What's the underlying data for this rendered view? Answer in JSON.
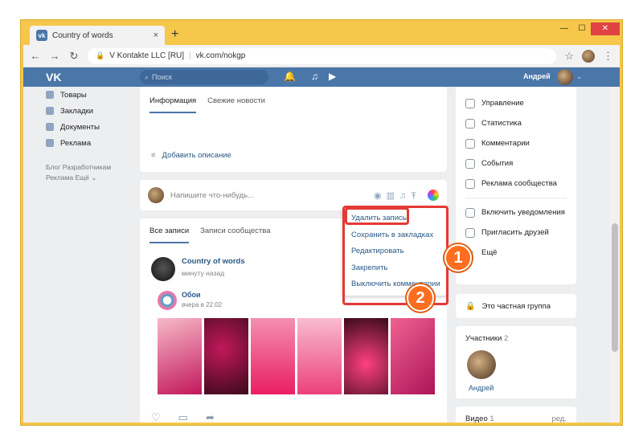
{
  "browser": {
    "tab_title": "Country of words",
    "tab_close": "×",
    "new_tab": "+",
    "address_origin": "V Kontakte LLC [RU]",
    "address_path": "vk.com/nokgp",
    "window_controls": [
      "—",
      "☐",
      "✕"
    ]
  },
  "vk_header": {
    "logo": "VK",
    "search_placeholder": "Поиск",
    "user_name": "Андрей"
  },
  "left_nav": {
    "items": [
      "Товары",
      "Закладки",
      "Документы",
      "Реклама"
    ],
    "footer_line1": "Блог   Разработчикам",
    "footer_line2": "Реклама   Ещё ⌄"
  },
  "info_card": {
    "tabs": [
      "Информация",
      "Свежие новости"
    ],
    "add_description": "Добавить описание"
  },
  "composer": {
    "placeholder": "Напишите что-нибудь..."
  },
  "wall": {
    "tabs": [
      "Все записи",
      "Записи сообщества"
    ],
    "post_author": "Country of words",
    "post_time": "минуту назад",
    "repost_author": "Обои",
    "repost_time": "вчера в 22:02"
  },
  "post_menu": {
    "items": [
      "Удалить запись",
      "Сохранить в закладках",
      "Редактировать",
      "Закрепить",
      "Выключить комментарии"
    ]
  },
  "right_col": {
    "items": [
      "Управление",
      "Статистика",
      "Комментарии",
      "События",
      "Реклама сообщества"
    ],
    "items2": [
      "Включить уведомления",
      "Пригласить друзей",
      "Ещё"
    ],
    "private_group": "Это частная группа",
    "members_label": "Участники",
    "members_count": "2",
    "member_name": "Андрей",
    "video_label": "Видео",
    "video_count": "1",
    "video_edit": "ред."
  },
  "badges": [
    "1",
    "2"
  ],
  "colors": {
    "vk_blue": "#4a76a8",
    "highlight_red": "#e53935",
    "badge_orange": "#ff6d1f"
  }
}
